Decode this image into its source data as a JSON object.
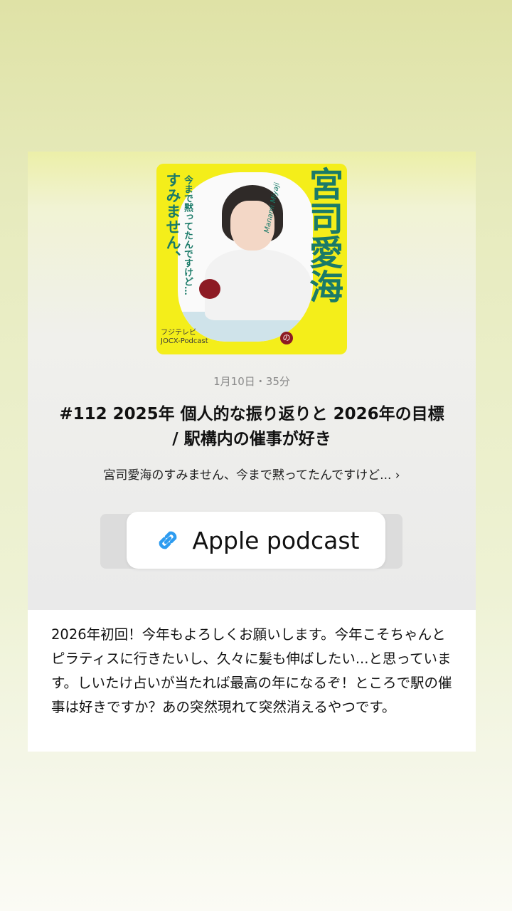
{
  "episode": {
    "meta": "1月10日・35分",
    "title": "#112 2025年 個人的な振り返りと 2026年の目標 / 駅構内の催事が好き",
    "show_link": "宮司愛海のすみません、今まで黙ってたんですけど... ›"
  },
  "artwork": {
    "title_vertical": "すみません、",
    "subtitle_vertical": "今まで黙ってたんですけど…",
    "name_vertical": "宮司愛海",
    "particle": "の",
    "signature": "Manami Miyaji",
    "brand_line1": "フジテレビ",
    "brand_line2": "JOCX-Podcast"
  },
  "link_sticker": {
    "label": "Apple podcast",
    "icon": "link-icon",
    "icon_color": "#2e9cf0"
  },
  "description": {
    "text": "2026年初回！今年もよろしくお願いします。今年こそちゃんとピラティスに行きたいし、久々に髪も伸ばしたい...と思っています。しいたけ占いが当たれば最高の年になるぞ！ところで駅の催事は好きですか？あの突然現れて突然消えるやつです。"
  },
  "colors": {
    "artwork_background": "#f4ee1a",
    "artwork_text": "#1a7a68",
    "accent_apple": "#8d1b24"
  }
}
